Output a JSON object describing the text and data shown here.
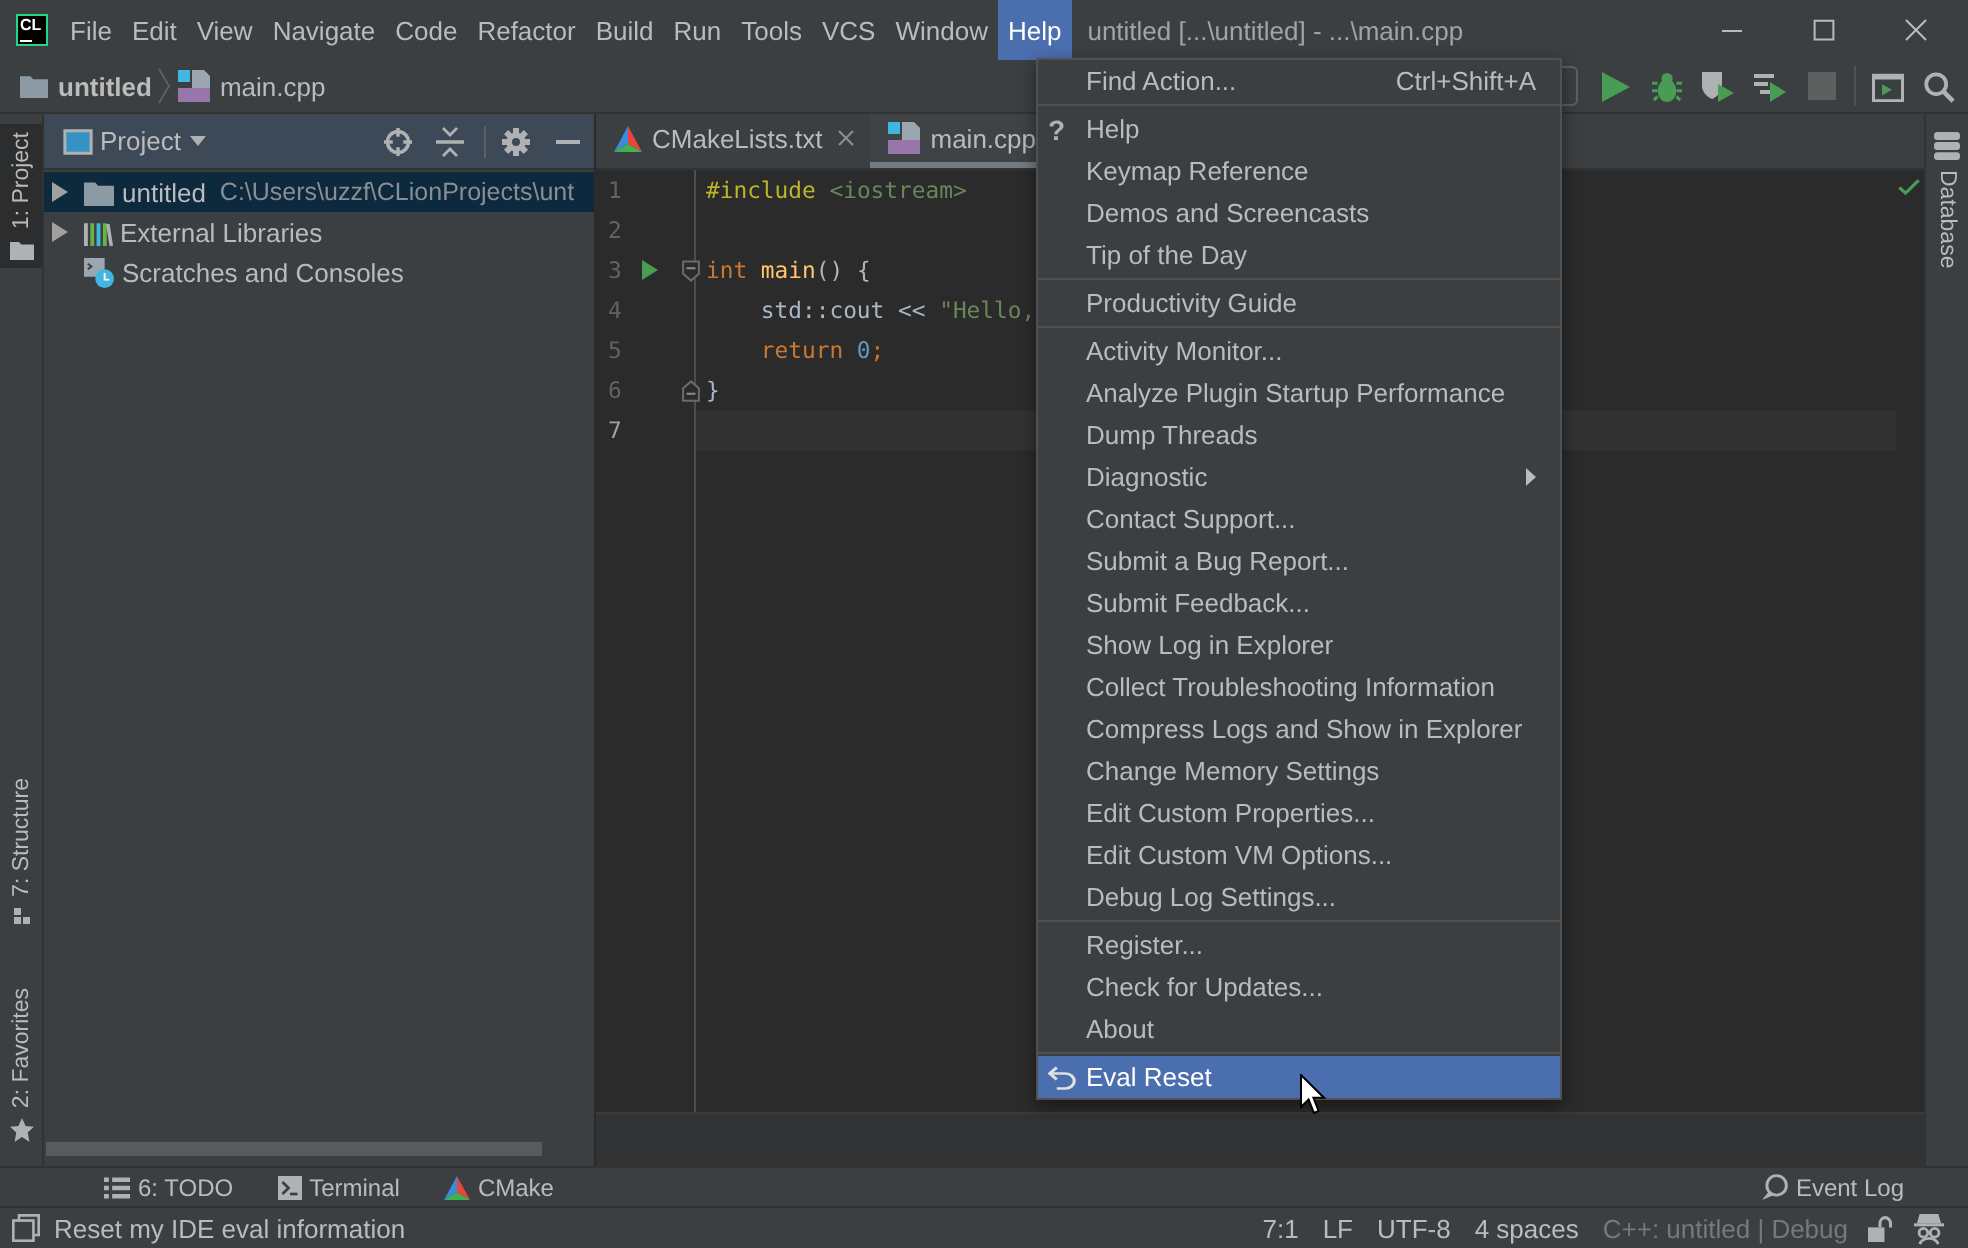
{
  "app": {
    "logo": "CL"
  },
  "menu_bar": [
    {
      "label": "File",
      "selected": false
    },
    {
      "label": "Edit",
      "selected": false
    },
    {
      "label": "View",
      "selected": false
    },
    {
      "label": "Navigate",
      "selected": false
    },
    {
      "label": "Code",
      "selected": false
    },
    {
      "label": "Refactor",
      "selected": false
    },
    {
      "label": "Build",
      "selected": false
    },
    {
      "label": "Run",
      "selected": false
    },
    {
      "label": "Tools",
      "selected": false
    },
    {
      "label": "VCS",
      "selected": false
    },
    {
      "label": "Window",
      "selected": false
    },
    {
      "label": "Help",
      "selected": true
    }
  ],
  "window": {
    "title": "untitled [...\\untitled] - ...\\main.cpp"
  },
  "breadcrumbs": [
    {
      "label": "untitled",
      "kind": "folder"
    },
    {
      "label": "main.cpp",
      "kind": "cpp"
    }
  ],
  "toolbar": [
    {
      "kind": "run",
      "disabled": false
    },
    {
      "kind": "debug",
      "disabled": false
    },
    {
      "kind": "coverage",
      "disabled": false
    },
    {
      "kind": "profile",
      "disabled": false
    },
    {
      "kind": "stop",
      "disabled": true
    },
    {
      "kind": "separator"
    },
    {
      "kind": "run-anything",
      "disabled": false
    },
    {
      "kind": "search",
      "disabled": false
    }
  ],
  "left_stripe": {
    "top": [
      {
        "label": "1: Project",
        "kind": "project",
        "selected": true
      }
    ],
    "bottom": [
      {
        "label": "7: Structure",
        "kind": "structure",
        "selected": false
      },
      {
        "label": "2: Favorites",
        "kind": "favorites",
        "selected": false
      }
    ]
  },
  "project_panel": {
    "title": "Project",
    "tree": [
      {
        "label": "untitled",
        "path": "C:\\Users\\uzzf\\CLionProjects\\unt",
        "kind": "folder",
        "expanded": false,
        "selected": true
      },
      {
        "label": "External Libraries",
        "kind": "libraries",
        "expanded": false,
        "selected": false
      },
      {
        "label": "Scratches and Consoles",
        "kind": "scratches",
        "selected": false
      }
    ]
  },
  "editor": {
    "tabs": [
      {
        "label": "CMakeLists.txt",
        "kind": "cmake",
        "selected": false,
        "closable": true
      },
      {
        "label": "main.cpp",
        "kind": "cpp",
        "selected": true
      }
    ],
    "no_problems": true,
    "lines": [
      {
        "number": "1",
        "current": false,
        "run_marker": false,
        "fold_start": false,
        "fold_end": false,
        "tokens": [
          {
            "text": "#include",
            "kind": "directive"
          },
          {
            "text": " <iostream>",
            "kind": "header"
          }
        ]
      },
      {
        "number": "2",
        "current": false,
        "run_marker": false,
        "fold_start": false,
        "fold_end": false
      },
      {
        "number": "3",
        "current": false,
        "run_marker": true,
        "fold_start": true,
        "fold_end": false,
        "tokens": [
          {
            "text": "int",
            "kind": "keyword"
          },
          {
            "text": " main",
            "kind": "function"
          },
          {
            "text": "() {",
            "kind": "plain"
          }
        ]
      },
      {
        "number": "4",
        "current": false,
        "run_marker": false,
        "fold_start": false,
        "fold_end": false,
        "tokens": [
          {
            "text": "    std::cout << ",
            "kind": "plain"
          },
          {
            "text": "\"Hello,",
            "kind": "string"
          }
        ]
      },
      {
        "number": "5",
        "current": false,
        "run_marker": false,
        "fold_start": false,
        "fold_end": false,
        "tokens": [
          {
            "text": "    return",
            "kind": "keyword"
          },
          {
            "text": " 0",
            "kind": "number"
          },
          {
            "text": ";",
            "kind": "keyword"
          }
        ]
      },
      {
        "number": "6",
        "current": false,
        "run_marker": false,
        "fold_start": false,
        "fold_end": true,
        "tokens": [
          {
            "text": "}",
            "kind": "plain"
          }
        ]
      },
      {
        "number": "7",
        "current": true,
        "run_marker": false,
        "fold_start": false,
        "fold_end": false
      }
    ]
  },
  "right_stripe": [
    {
      "label": "Database",
      "kind": "database",
      "selected": false
    }
  ],
  "tool_window_bar": {
    "left": [
      {
        "label": "6: TODO",
        "kind": "todo"
      },
      {
        "label": "Terminal",
        "kind": "terminal"
      },
      {
        "label": "CMake",
        "kind": "cmake"
      }
    ],
    "right": [
      {
        "label": "Event Log",
        "kind": "event-log"
      }
    ]
  },
  "status_bar": {
    "message": "Reset my IDE eval information",
    "items": [
      {
        "text": "7:1",
        "disabled": false
      },
      {
        "text": "LF",
        "disabled": false
      },
      {
        "text": "UTF-8",
        "disabled": false
      },
      {
        "text": "4 spaces",
        "disabled": false
      },
      {
        "text": "C++: untitled | Debug",
        "disabled": true
      }
    ]
  },
  "help_menu": {
    "groups": [
      [
        {
          "label": "Find Action...",
          "shortcut": "Ctrl+Shift+A",
          "kind": "action",
          "selected": false
        }
      ],
      [
        {
          "label": "Help",
          "glyph": "?",
          "kind": "action",
          "selected": false
        },
        {
          "label": "Keymap Reference",
          "kind": "action",
          "selected": false
        },
        {
          "label": "Demos and Screencasts",
          "kind": "action",
          "selected": false
        },
        {
          "label": "Tip of the Day",
          "kind": "action",
          "selected": false
        }
      ],
      [
        {
          "label": "Productivity Guide",
          "kind": "action",
          "selected": false
        }
      ],
      [
        {
          "label": "Activity Monitor...",
          "kind": "action",
          "selected": false
        },
        {
          "label": "Analyze Plugin Startup Performance",
          "kind": "action",
          "selected": false
        },
        {
          "label": "Dump Threads",
          "kind": "action",
          "selected": false
        },
        {
          "label": "Diagnostic",
          "kind": "submenu",
          "selected": false
        },
        {
          "label": "Contact Support...",
          "kind": "action",
          "selected": false
        },
        {
          "label": "Submit a Bug Report...",
          "kind": "action",
          "selected": false
        },
        {
          "label": "Submit Feedback...",
          "kind": "action",
          "selected": false
        },
        {
          "label": "Show Log in Explorer",
          "kind": "action",
          "selected": false
        },
        {
          "label": "Collect Troubleshooting Information",
          "kind": "action",
          "selected": false
        },
        {
          "label": "Compress Logs and Show in Explorer",
          "kind": "action",
          "selected": false
        },
        {
          "label": "Change Memory Settings",
          "kind": "action",
          "selected": false
        },
        {
          "label": "Edit Custom Properties...",
          "kind": "action",
          "selected": false
        },
        {
          "label": "Edit Custom VM Options...",
          "kind": "action",
          "selected": false
        },
        {
          "label": "Debug Log Settings...",
          "kind": "action",
          "selected": false
        }
      ],
      [
        {
          "label": "Register...",
          "kind": "action",
          "selected": false
        },
        {
          "label": "Check for Updates...",
          "kind": "action",
          "selected": false
        },
        {
          "label": "About",
          "kind": "action",
          "selected": false
        }
      ],
      [
        {
          "label": "Eval Reset",
          "kind": "plugin",
          "selected": true
        }
      ]
    ]
  }
}
